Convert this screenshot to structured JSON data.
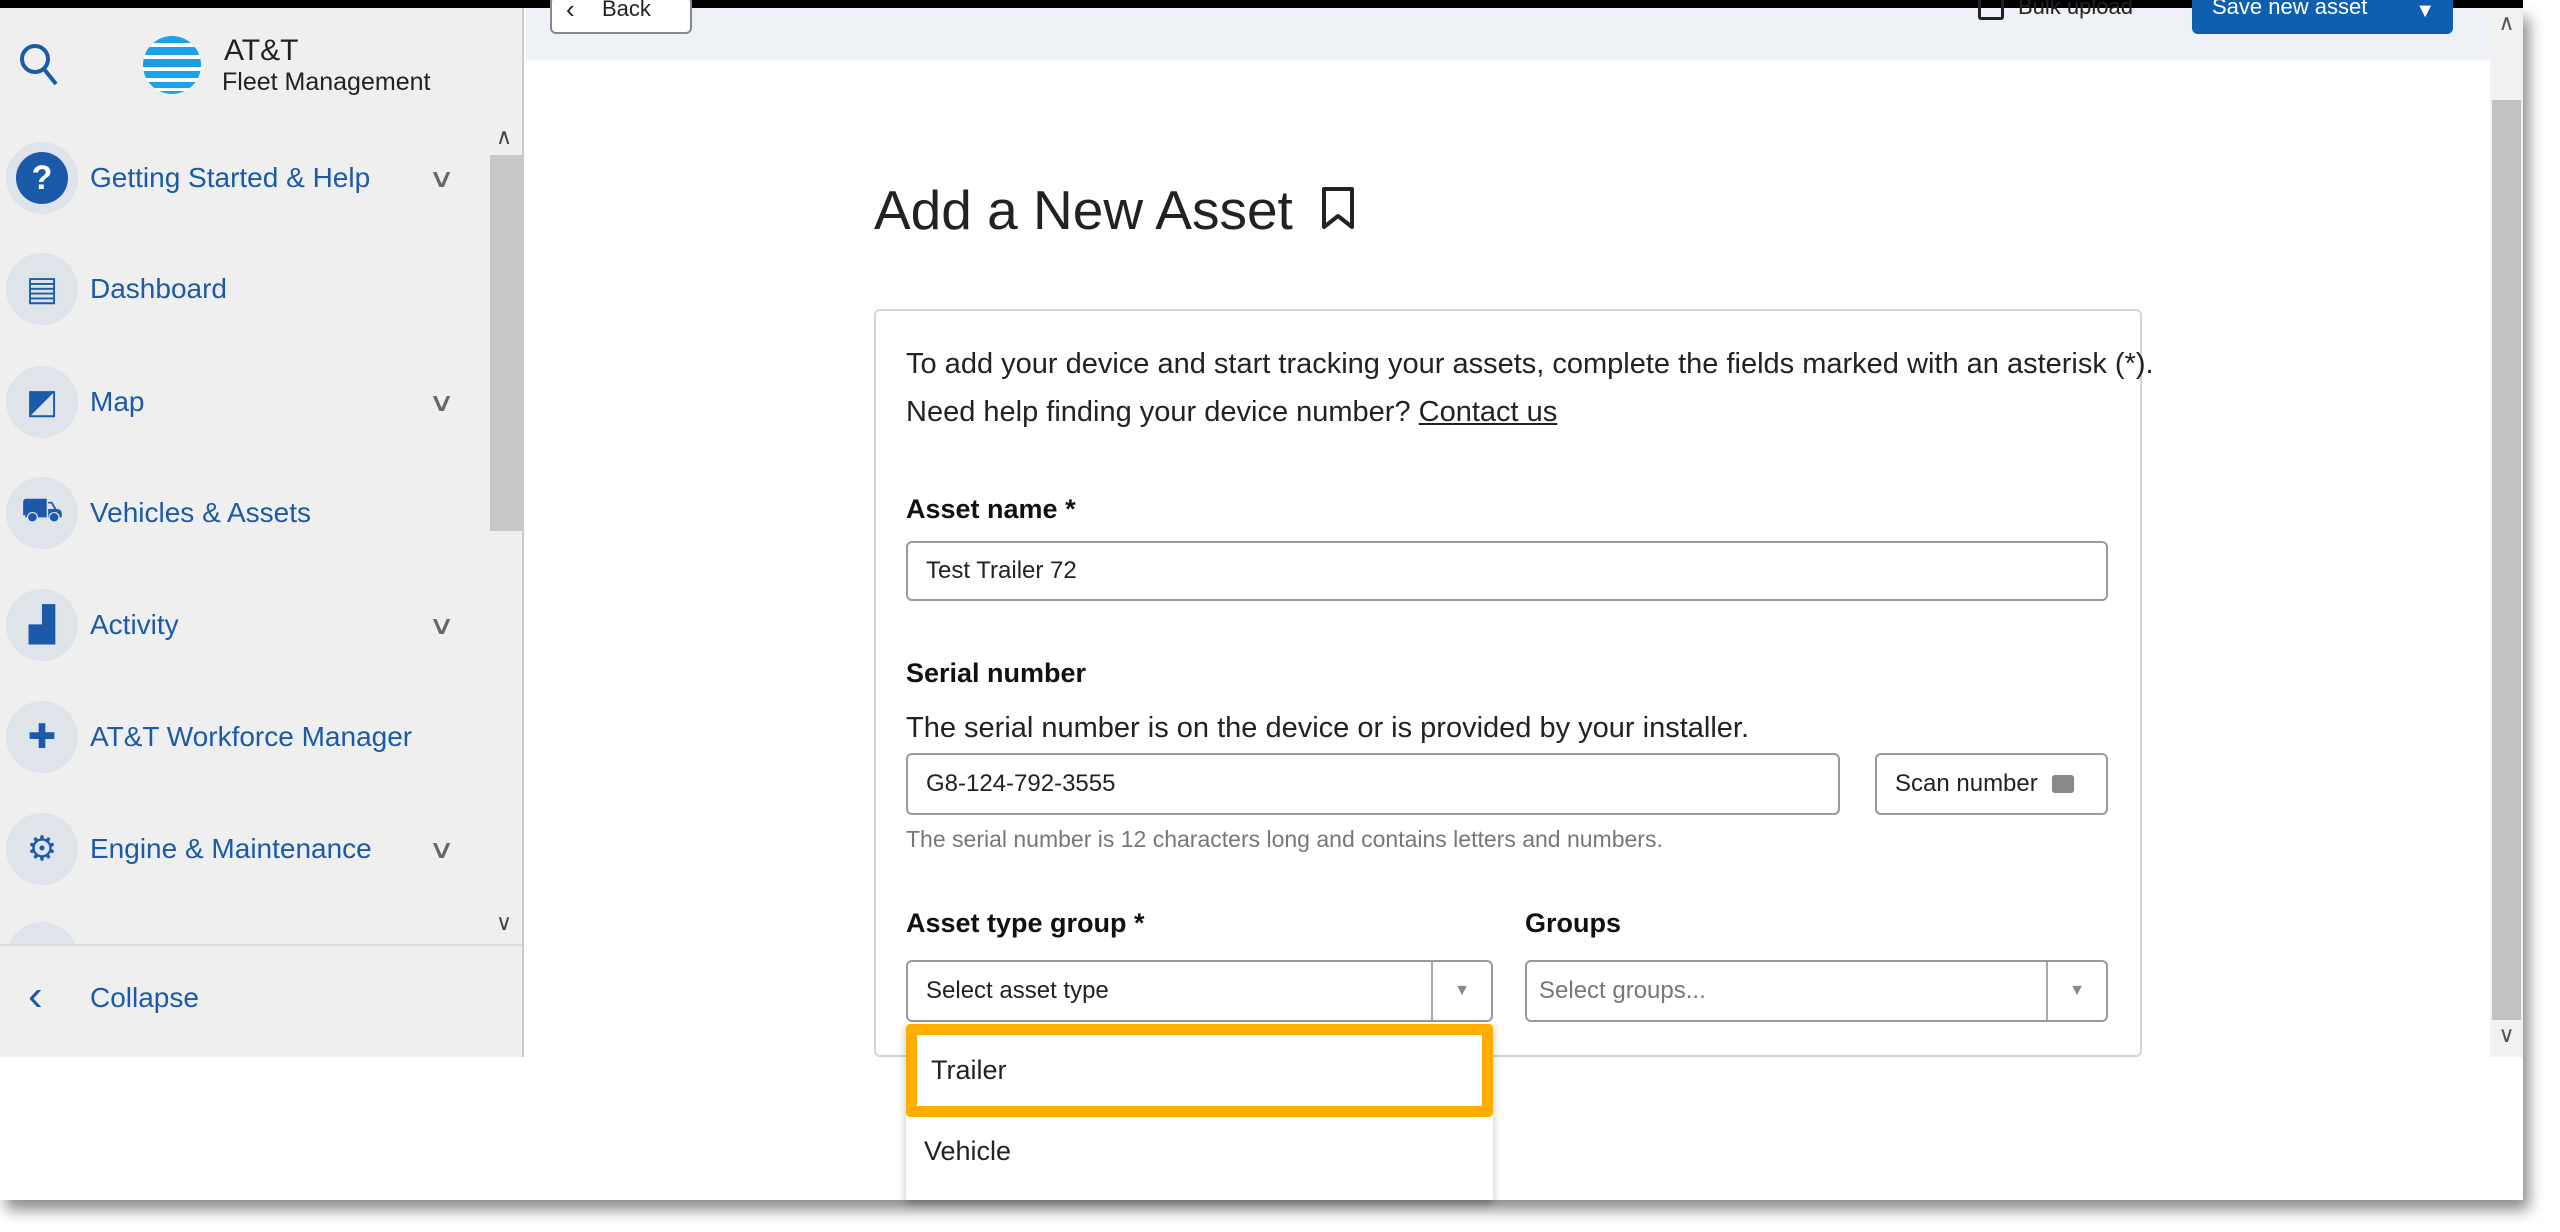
{
  "app": {
    "logo_line1": "AT&T",
    "logo_line2": "Fleet Management",
    "brand_color": "#0f5fb0",
    "highlight_color": "#ffae00"
  },
  "header": {
    "back_label": "Back",
    "bulk_upload_label": "Bulk upload",
    "save_label": "Save new asset"
  },
  "sidebar": {
    "items": [
      {
        "label": "Getting Started & Help",
        "icon": "help-icon",
        "expandable": true
      },
      {
        "label": "Dashboard",
        "icon": "dashboard-icon",
        "expandable": false
      },
      {
        "label": "Map",
        "icon": "map-icon",
        "expandable": true
      },
      {
        "label": "Vehicles & Assets",
        "icon": "truck-icon",
        "expandable": false
      },
      {
        "label": "Activity",
        "icon": "activity-chart-icon",
        "expandable": true
      },
      {
        "label": "AT&T Workforce Manager",
        "icon": "puzzle-icon",
        "expandable": false
      },
      {
        "label": "Engine & Maintenance",
        "icon": "engine-icon",
        "expandable": true
      }
    ],
    "collapse_label": "Collapse"
  },
  "page": {
    "title": "Add a New Asset",
    "intro": "To add your device and start tracking your assets, complete the fields marked with an asterisk (*).",
    "help_text": "Need help finding your device number?",
    "contact_link": "Contact us",
    "asset_name_label": "Asset name *",
    "asset_name_value": "Test Trailer 72",
    "serial_label": "Serial number",
    "serial_desc": "The serial number is on the device or is provided by your installer.",
    "serial_value": "G8-124-792-3555",
    "scan_label": "Scan number",
    "serial_hint": "The serial number is 12 characters long and contains letters and numbers.",
    "asset_type_label": "Asset type group *",
    "asset_type_value": "Select asset type",
    "groups_label": "Groups",
    "groups_placeholder": "Select groups...",
    "asset_type_options": [
      "Trailer",
      "Vehicle"
    ],
    "highlighted_option": "Trailer"
  }
}
